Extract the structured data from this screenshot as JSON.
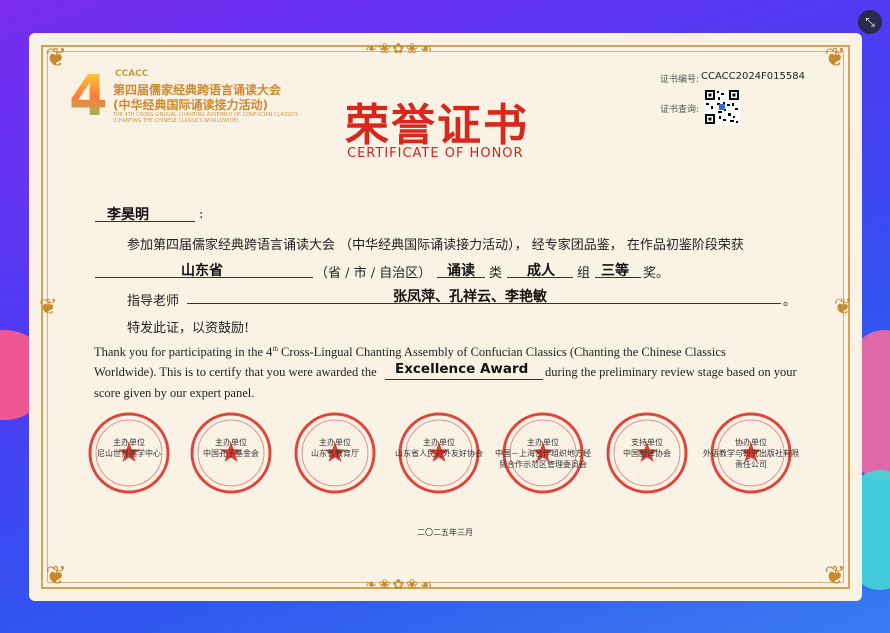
{
  "window": {
    "close_icon": "close-fullscreen-icon"
  },
  "logo": {
    "number": "4",
    "brand": "CCACC",
    "title_line1": "第四届儒家经典跨语言诵读大会",
    "title_line2": "(中华经典国际诵读接力活动)",
    "en_line1": "THE 4TH CROSS-LINGUAL CHANTING ASSEMBLY OF CONFUCIAN CLASSICS",
    "en_line2": "(CHANTING THE CHINESE CLASSICS WORLDWIDE)"
  },
  "title": {
    "cn": "荣誉证书",
    "en": "CERTIFICATE OF HONOR"
  },
  "meta": {
    "cert_no_label": "证书编号:",
    "cert_no": "CCACC2024F015584",
    "query_label": "证书查询:"
  },
  "body": {
    "recipient": "李昊明",
    "colon": ":",
    "line1": "参加第四届儒家经典跨语言诵读大会 （中华经典国际诵读接力活动）， 经专家团品鉴， 在作品初鉴阶段荣获",
    "province": "山东省",
    "province_suffix": "（省 / 市 / 自治区）",
    "category": "诵读",
    "category_suffix": "类",
    "group": "成人",
    "group_suffix": "组",
    "award": "三等",
    "award_suffix": "奖。",
    "teacher_label": "指导老师",
    "teachers": "张凤萍、孔祥云、李艳敏",
    "teacher_end": "。",
    "closing": "特发此证，以资鼓励!"
  },
  "english": {
    "line1_a": "Thank you for participating in the 4",
    "line1_sup": "th",
    "line1_b": " Cross-Lingual Chanting Assembly of Confucian Classics (Chanting the Chinese Classics",
    "line2_a": "Worldwide). This is to certify that you were awarded the",
    "award": "Excellence Award",
    "line2_b": "during the preliminary review stage based on your",
    "line3": "score given by our expert panel."
  },
  "seals": [
    {
      "role": "主办单位",
      "org": "尼山世界儒学中心"
    },
    {
      "role": "主办单位",
      "org": "中国孔子基金会"
    },
    {
      "role": "主办单位",
      "org": "山东省教育厅"
    },
    {
      "role": "主办单位",
      "org": "山东省人民对外友好协会"
    },
    {
      "role": "主办单位",
      "org": "中国－上海合作组织地方经贸合作示范区管理委员会"
    },
    {
      "role": "支持单位",
      "org": "中国翻译协会"
    },
    {
      "role": "协办单位",
      "org": "外语教学与研究出版社有限责任公司"
    }
  ],
  "date": "二〇二五年三月",
  "colors": {
    "title_red": "#d8281e",
    "gold": "#c88a2c",
    "seal_red": "#d8281e"
  }
}
